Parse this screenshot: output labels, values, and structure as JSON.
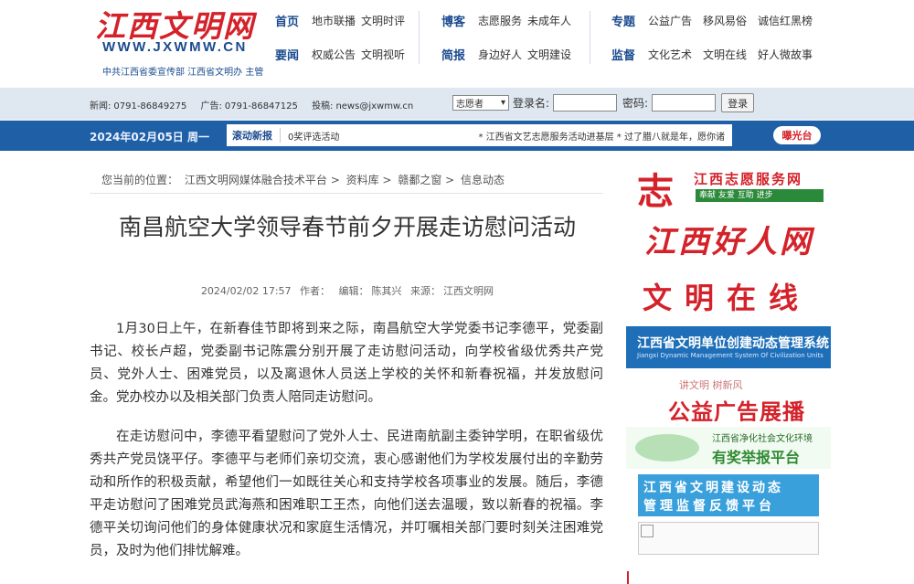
{
  "logo": {
    "title": "江西文明网",
    "url": "WWW.JXWMW.CN",
    "subtitle": "中共江西省委宣传部  江西省文明办 主管"
  },
  "nav": {
    "group1": {
      "row1": {
        "head": "首页",
        "items": [
          "地市联播",
          "文明时评"
        ]
      },
      "row2": {
        "head": "要闻",
        "items": [
          "权威公告",
          "文明视听"
        ]
      }
    },
    "group2": {
      "row1": {
        "head": "博客",
        "items": [
          "志愿服务",
          "未成年人"
        ]
      },
      "row2": {
        "head": "简报",
        "items": [
          "身边好人",
          "文明建设"
        ]
      }
    },
    "group3": {
      "row1": {
        "head": "专题",
        "items": [
          "公益广告",
          "移风易俗",
          "诚信红黑榜"
        ]
      },
      "row2": {
        "head": "监督",
        "items": [
          "文化艺术",
          "文明在线",
          "好人微故事"
        ]
      }
    }
  },
  "infobar": {
    "news_label": "新闻:",
    "news_phone": "0791-86849275",
    "ad_label": "广告:",
    "ad_phone": "0791-86847125",
    "submit_label": "投稿:",
    "submit_email": "news@jxwmw.cn",
    "select_value": "志愿者",
    "login_label": "登录名:",
    "password_label": "密码:",
    "login_button": "登录"
  },
  "bluebar": {
    "date": "2024年02月05日 周一",
    "ticker_label": "滚动新报",
    "ticker_text1": "0奖评选活动",
    "ticker_text2": "* 江西省文艺志愿服务活动进基层 * 过了腊八就是年，愿你诸",
    "expose_button": "曝光台"
  },
  "breadcrumb": {
    "prefix": "您当前的位置：",
    "items": [
      "江西文明网媒体融合技术平台",
      ">",
      "资料库",
      ">",
      "赣鄱之窗",
      ">",
      "信息动态"
    ]
  },
  "article": {
    "title": "南昌航空大学领导春节前夕开展走访慰问活动",
    "datetime": "2024/02/02 17:57",
    "author_label": "作者：",
    "editor_label": "编辑：",
    "editor": "陈其兴",
    "source_label": "来源：",
    "source": "江西文明网",
    "paragraphs": [
      "1月30日上午，在新春佳节即将到来之际，南昌航空大学党委书记李德平，党委副书记、校长卢超，党委副书记陈震分别开展了走访慰问活动，向学校省级优秀共产党员、党外人士、困难党员，以及离退休人员送上学校的关怀和新春祝福，并发放慰问金。党办校办以及相关部门负责人陪同走访慰问。",
      "在走访慰问中，李德平看望慰问了党外人士、民进南航副主委钟学明，在职省级优秀共产党员饶平仔。李德平与老师们亲切交流，衷心感谢他们为学校发展付出的辛勤劳动和所作的积极贡献，希望他们一如既往关心和支持学校各项事业的发展。随后，李德平走访慰问了困难党员武海燕和困难职工王杰，向他们送去温暖，致以新春的祝福。李德平关切询问他们的身体健康状况和家庭生活情况，并叮嘱相关部门要时刻关注困难党员，及时为他们排忧解难。"
    ]
  },
  "sidebar": {
    "b1_mark": "志",
    "b1_title": "江西志愿服务网",
    "b1_sub": "奉献 友爱 互助 进步",
    "b2_title": "江西好人网",
    "b3_title": "文明在线",
    "b4_title": "江西省文明单位创建动态管理系统",
    "b4_sub": "Jiangxi Dynamic Management System Of Civilization Units",
    "b5_sub": "讲文明  树新风",
    "b5_title": "公益广告展播",
    "b6_sub": "江西省净化社会文化环境",
    "b6_title": "有奖举报平台",
    "b7_line1": "江西省文明建设动态",
    "b7_line2": "管理监督反馈平台"
  }
}
